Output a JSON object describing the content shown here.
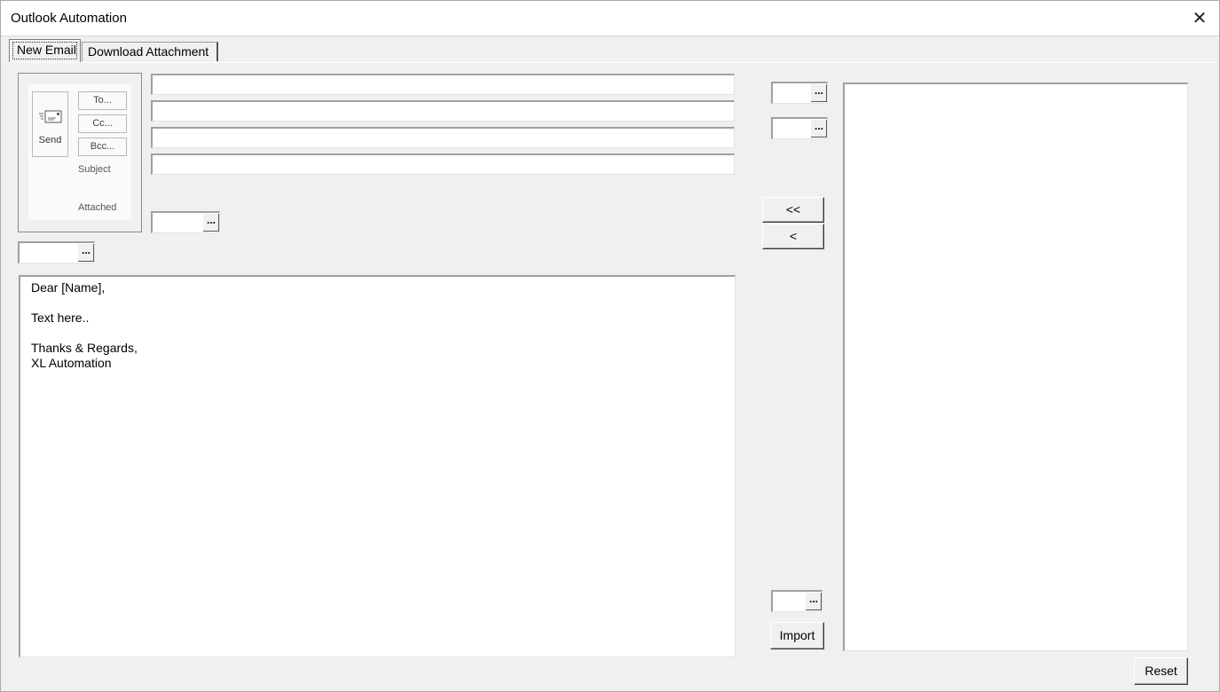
{
  "window": {
    "title": "Outlook Automation",
    "close_glyph": "✕"
  },
  "tabs": [
    {
      "label": "New Email",
      "active": true
    },
    {
      "label": "Download Attachment",
      "active": false
    }
  ],
  "email_header": {
    "send_label": "Send",
    "to_label": "To...",
    "cc_label": "Cc...",
    "bcc_label": "Bcc...",
    "subject_label": "Subject",
    "attached_label": "Attached"
  },
  "fields": {
    "to": "",
    "cc": "",
    "bcc": "",
    "subject": ""
  },
  "picker_glyph": "...",
  "body": "Dear [Name],\n\nText here..\n\nThanks & Regards,\nXL Automation",
  "buttons": {
    "move_all": "<<",
    "move_one": "<",
    "import": "Import",
    "reset": "Reset"
  }
}
